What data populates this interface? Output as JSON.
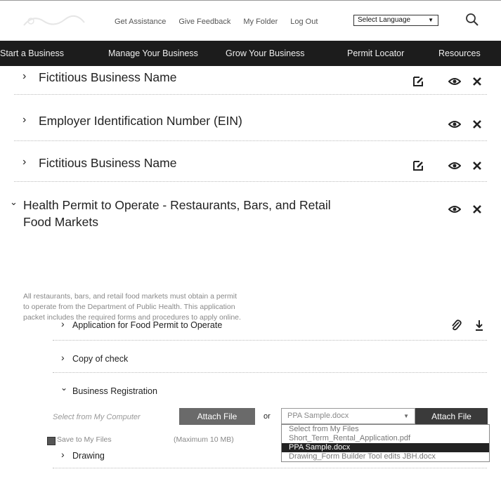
{
  "header": {
    "links": [
      "Get Assistance",
      "Give Feedback",
      "My Folder",
      "Log Out"
    ],
    "language_select": "Select Language"
  },
  "nav": {
    "items": [
      "Start a Business",
      "Manage Your Business",
      "Grow Your Business",
      "Permit Locator",
      "Resources"
    ]
  },
  "sections": [
    {
      "title": "Fictitious Business Name"
    },
    {
      "title": "Employer Identification Number (EIN)"
    },
    {
      "title": "Fictitious Business Name"
    },
    {
      "title_line1": "Health Permit to Operate - Restaurants, Bars, and Retail",
      "title_line2": "Food Markets"
    }
  ],
  "description": "All restaurants, bars, and retail food markets must obtain a permit to operate from the Department of Public Health. This application packet includes the required forms and procedures to apply online.",
  "subitems": [
    {
      "title": "Application for Food Permit to Operate"
    },
    {
      "title": "Copy of check"
    },
    {
      "title": "Business Registration"
    },
    {
      "title": "Drawing"
    }
  ],
  "upload": {
    "computer_label": "Select from My Computer",
    "attach_label": "Attach File",
    "or_label": "or",
    "selected_file": "PPA Sample.docx",
    "attach_label_2": "Attach File",
    "save_label": "Save to My Files",
    "max_label": "(Maximum 10 MB)",
    "options": [
      "Select from My Files",
      "Short_Term_Rental_Application.pdf",
      "PPA Sample.docx",
      "Drawing_Form Builder Tool edits JBH.docx"
    ],
    "selected_index": 2
  },
  "colors": {
    "nav_bg": "#1c1c1c",
    "button_bg": "#555555",
    "dropdown_selected": "#222222"
  }
}
